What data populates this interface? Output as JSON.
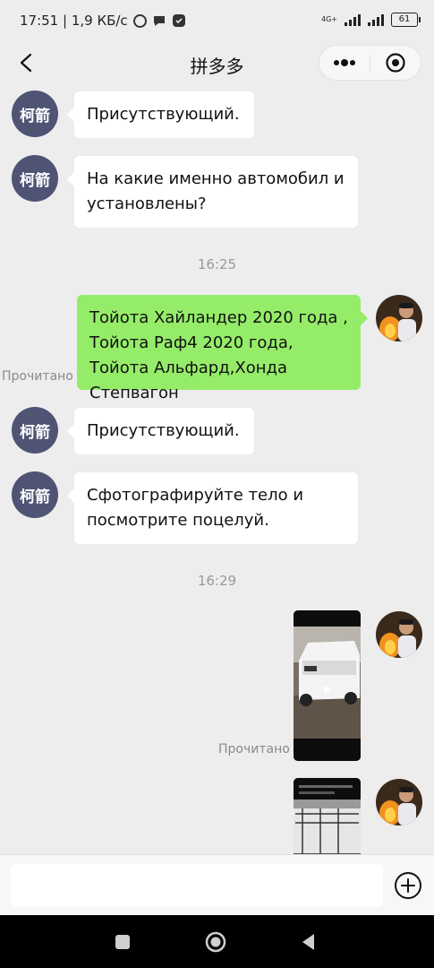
{
  "status_bar": {
    "time_speed": "17:51 | 1,9 КБ/с",
    "network_label": "4G+",
    "battery": "61"
  },
  "header": {
    "title": "拼多多"
  },
  "chat": {
    "messages": [
      {
        "from": "other",
        "avatar_text": "柯箭",
        "text": "Присутствующий."
      },
      {
        "from": "other",
        "avatar_text": "柯箭",
        "text": "На какие именно автомобил и установлены?"
      },
      {
        "time": "16:25"
      },
      {
        "from": "me",
        "text": "Тойота Хайландер 2020 года , Тойота Раф4 2020 года, Тойота Альфард,Хонда Степвагон",
        "status": "Прочитано"
      },
      {
        "from": "other",
        "avatar_text": "柯箭",
        "text": "Присутствующий."
      },
      {
        "from": "other",
        "avatar_text": "柯箭",
        "text": "Сфотографируйте тело и посмотрите поцелуй."
      },
      {
        "time": "16:29"
      },
      {
        "from": "me",
        "type": "video",
        "status": "Прочитано"
      },
      {
        "from": "me",
        "type": "video"
      }
    ]
  },
  "input": {
    "value": "",
    "placeholder": ""
  },
  "icons": {
    "back": "back-chevron-icon",
    "more": "more-dots-icon",
    "close": "close-target-icon",
    "plus": "plus-circle-icon",
    "nav_recent": "square-recent-icon",
    "nav_home": "circle-home-icon",
    "nav_back": "triangle-back-icon"
  },
  "colors": {
    "background": "#ededed",
    "bubble_me": "#95ec69",
    "bubble_other": "#ffffff",
    "avatar_other": "#4f5475"
  }
}
